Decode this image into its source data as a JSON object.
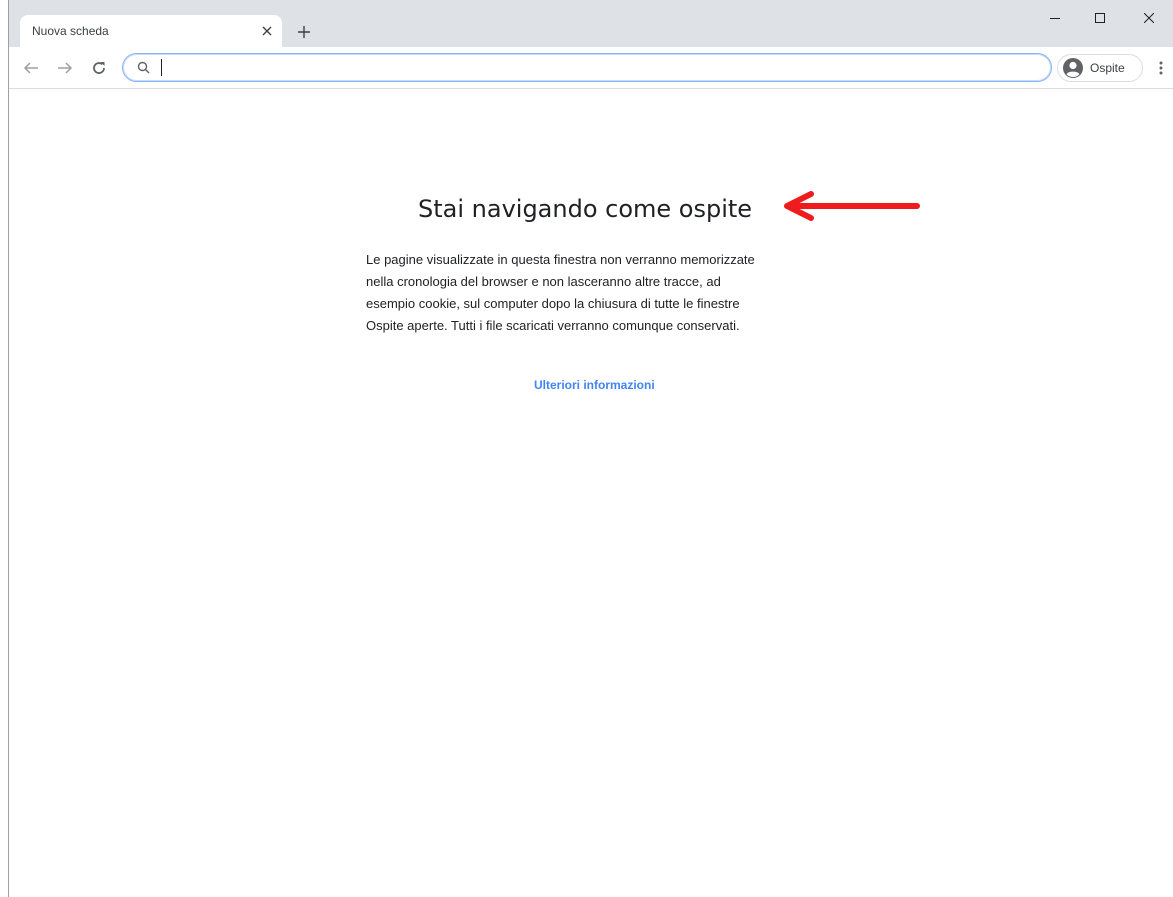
{
  "tab": {
    "title": "Nuova scheda",
    "close_icon": "close-icon"
  },
  "window_controls": {
    "minimize_icon": "minimize-icon",
    "maximize_icon": "maximize-icon",
    "close_icon": "close-icon"
  },
  "toolbar": {
    "back_icon": "arrow-left-icon",
    "forward_icon": "arrow-right-icon",
    "reload_icon": "reload-icon",
    "omnibox_value": "",
    "profile_label": "Ospite",
    "menu_icon": "kebab-menu-icon"
  },
  "page": {
    "headline": "Stai navigando come ospite",
    "description_lines": [
      "Le pagine visualizzate in questa finestra non verranno memorizzate",
      "nella cronologia del browser e non lasceranno altre tracce, ad",
      "esempio cookie, sul computer dopo la chiusura di tutte le finestre",
      "Ospite aperte. Tutti i file scaricati verranno comunque conservati."
    ],
    "learn_more": "Ulteriori informazioni"
  },
  "colors": {
    "annotation_arrow": "#ee1c1c",
    "link": "#4285f4",
    "tabstrip": "#dee1e6"
  }
}
